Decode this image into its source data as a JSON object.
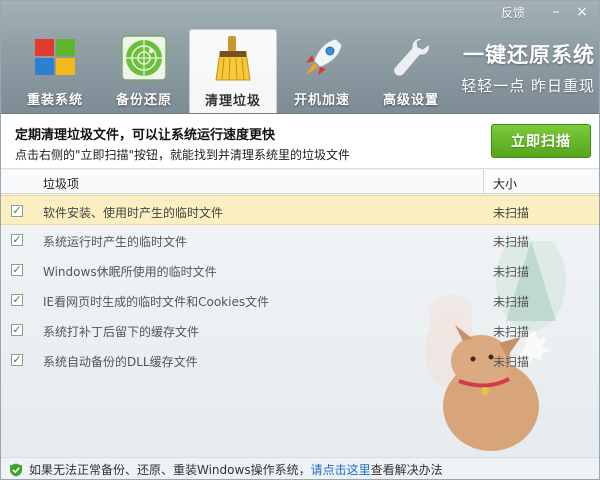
{
  "titlebar": {
    "feedback": "反馈",
    "minimize": "–",
    "close": "×"
  },
  "nav": {
    "items": [
      {
        "label": "重装系统",
        "icon": "windows-logo-icon"
      },
      {
        "label": "备份还原",
        "icon": "radar-icon"
      },
      {
        "label": "清理垃圾",
        "icon": "broom-icon"
      },
      {
        "label": "开机加速",
        "icon": "rocket-icon"
      },
      {
        "label": "高级设置",
        "icon": "wrench-icon"
      }
    ],
    "active": "清理垃圾"
  },
  "slogan": {
    "title": "一键还原系统",
    "subtitle": "轻轻一点  昨日重现"
  },
  "info": {
    "title": "定期清理垃圾文件，可以让系统运行速度更快",
    "description": "点击右侧的\"立即扫描\"按钮，就能找到并清理系统里的垃圾文件",
    "scan_button": "立即扫描"
  },
  "table": {
    "columns": {
      "name": "垃圾项",
      "size": "大小"
    },
    "rows": [
      {
        "name": "软件安装、使用时产生的临时文件",
        "size": "未扫描",
        "checked": true,
        "selected": true
      },
      {
        "name": "系统运行时产生的临时文件",
        "size": "未扫描",
        "checked": true,
        "selected": false
      },
      {
        "name": "Windows休眠所使用的临时文件",
        "size": "未扫描",
        "checked": true,
        "selected": false
      },
      {
        "name": "IE看网页时生成的临时文件和Cookies文件",
        "size": "未扫描",
        "checked": true,
        "selected": false
      },
      {
        "name": "系统打补丁后留下的缓存文件",
        "size": "未扫描",
        "checked": true,
        "selected": false
      },
      {
        "name": "系统自动备份的DLL缓存文件",
        "size": "未扫描",
        "checked": true,
        "selected": false
      }
    ]
  },
  "footer": {
    "text_before": "如果无法正常备份、还原、重装Windows操作系统，",
    "link": "请点击这里",
    "text_after": "查看解决办法"
  },
  "colors": {
    "accent_green": "#55a61c",
    "link_blue": "#1a6fc4",
    "selected_row": "#fbeec0"
  }
}
